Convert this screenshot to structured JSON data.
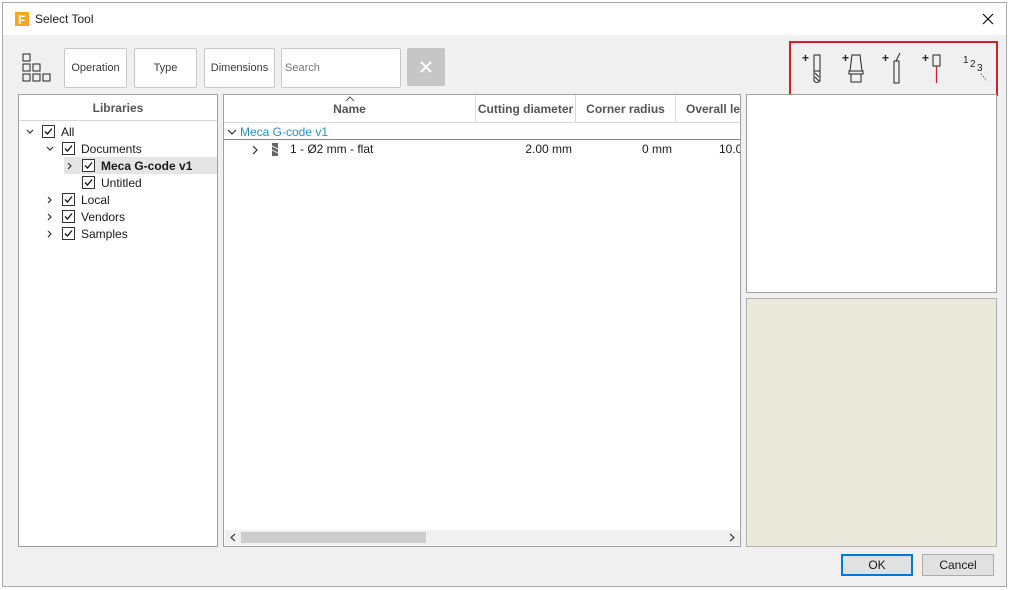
{
  "window": {
    "title": "Select Tool"
  },
  "toolbar": {
    "filters": {
      "operation": "Operation",
      "type": "Type",
      "dimensions": "Dimensions"
    },
    "search_placeholder": "Search",
    "tool_icons": [
      "new-milling-tool-icon",
      "new-holder-icon",
      "new-turning-tool-icon",
      "new-probe-icon",
      "renumber-tools-icon"
    ]
  },
  "libraries": {
    "header": "Libraries",
    "items": [
      {
        "label": "All"
      },
      {
        "label": "Documents"
      },
      {
        "label": "Meca G-code v1"
      },
      {
        "label": "Untitled"
      },
      {
        "label": "Local"
      },
      {
        "label": "Vendors"
      },
      {
        "label": "Samples"
      }
    ]
  },
  "table": {
    "columns": [
      "Name",
      "Cutting diameter",
      "Corner radius",
      "Overall len"
    ],
    "group": "Meca G-code v1",
    "rows": [
      {
        "name": "1 - Ø2 mm - flat",
        "cutting_diameter": "2.00 mm",
        "corner_radius": "0 mm",
        "overall_length": "10.0"
      }
    ]
  },
  "buttons": {
    "ok": "OK",
    "cancel": "Cancel"
  },
  "colors": {
    "accent": "#0078d7",
    "highlight_box": "#d32028",
    "group_text": "#2a8fbf",
    "preview_bg": "#ebe8dc"
  }
}
